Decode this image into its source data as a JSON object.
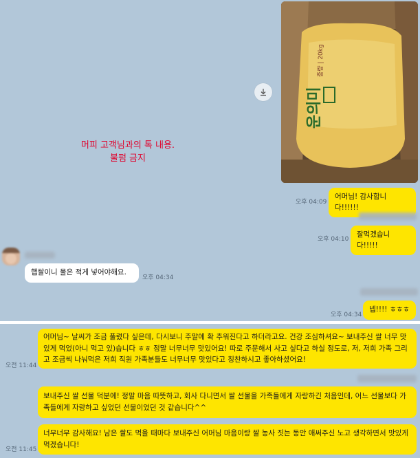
{
  "watermark": {
    "line1": "머피 고객님과의 톡 내용.",
    "line2": "불펌 금지"
  },
  "photo": {
    "bag_text_1": "운의미",
    "bag_text_2": "중량 | 20kg"
  },
  "messages": {
    "m1": {
      "text": "어머님! 감사합니다!!!!!!",
      "time": "오후 04:09"
    },
    "m2": {
      "text": "잘먹겠습니다!!!!!",
      "time": "오후 04:10"
    },
    "m3": {
      "text": "햅쌀이니 물은 적게 넣어야해요.",
      "time": "오후 04:34"
    },
    "m4": {
      "text": "넵!!!! ㅎㅎㅎ",
      "time": "오후 04:34"
    },
    "m5": {
      "text": "어머님~ 날씨가 조금 풀렸다 싶은데, 다시보니 주말에 확 추워진다고 하더라고요. 건강 조심하셔요~ 보내주신 쌀 너무 맛있게 먹었(아니 먹고 있)습니다 ㅎㅎ 정말 너무너무 맛있어요! 따로 주문해서 사고 싶다고 하실 정도로, 저, 저희 가족 그리고 조금씩 나눠먹은 저희 직원 가족분들도 너무너무 맛있다고 칭찬하시고 좋아하셨어요!",
      "time": "오전 11:44"
    },
    "m6": {
      "text": "보내주신 쌀 선물 덕분에! 정말 마음 따뜻하고, 회사 다니면서 쌀 선물을 가족들에게 자랑하긴 처음인데, 어느 선물보다 가족들에게 자랑하고 싶었던 선물이었던 것 같습니다^^"
    },
    "m7": {
      "text": "너무너무 감사해요! 남은 쌀도 먹을 때마다 보내주신 어머님 마음이랑 쌀 농사 짓는 동안 애써주신 노고 생각하면서 맛있게 먹겠습니다!",
      "time": "오전 11:45"
    }
  },
  "icons": {
    "download": "download-icon",
    "avatar": "profile-avatar"
  }
}
